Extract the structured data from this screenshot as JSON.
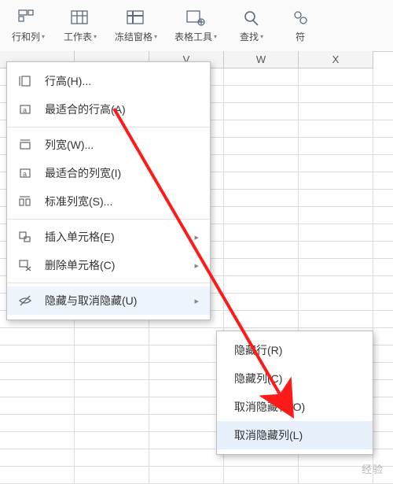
{
  "toolbar": [
    {
      "name": "rowcol",
      "label": "行和列",
      "icon": "rowcol",
      "chev": true
    },
    {
      "name": "worksheet",
      "label": "工作表",
      "icon": "sheet",
      "chev": true
    },
    {
      "name": "freeze",
      "label": "冻结窗格",
      "icon": "freeze",
      "chev": true
    },
    {
      "name": "tabletools",
      "label": "表格工具",
      "icon": "tools",
      "chev": true
    },
    {
      "name": "find",
      "label": "查找",
      "icon": "find",
      "chev": true
    },
    {
      "name": "symbol",
      "label": "符",
      "icon": "symbol",
      "chev": false
    }
  ],
  "col_headers": [
    "",
    "",
    "V",
    "W",
    "X"
  ],
  "menu": {
    "items": [
      {
        "id": "row-height",
        "icon": "rowh",
        "label": "行高(H)..."
      },
      {
        "id": "autofit-row",
        "icon": "autorow",
        "label": "最适合的行高(A)"
      },
      {
        "id": "sep1",
        "sep": true
      },
      {
        "id": "col-width",
        "icon": "colw",
        "label": "列宽(W)..."
      },
      {
        "id": "autofit-col",
        "icon": "autocol",
        "label": "最适合的列宽(I)"
      },
      {
        "id": "std-col",
        "icon": "stdcol",
        "label": "标准列宽(S)..."
      },
      {
        "id": "sep2",
        "sep": true
      },
      {
        "id": "insert-cell",
        "icon": "insert",
        "label": "插入单元格(E)",
        "arrow": true
      },
      {
        "id": "delete-cell",
        "icon": "delete",
        "label": "删除单元格(C)",
        "arrow": true
      },
      {
        "id": "sep3",
        "sep": true
      },
      {
        "id": "hide-unhide",
        "icon": "hide",
        "label": "隐藏与取消隐藏(U)",
        "arrow": true,
        "hover": true
      }
    ]
  },
  "submenu": {
    "items": [
      {
        "id": "hide-row",
        "label": "隐藏行(R)"
      },
      {
        "id": "hide-col",
        "label": "隐藏列(C)"
      },
      {
        "id": "unhide-row",
        "label": "取消隐藏行(O)"
      },
      {
        "id": "unhide-col",
        "label": "取消隐藏列(L)",
        "hover": true
      }
    ]
  },
  "watermark": "经验"
}
